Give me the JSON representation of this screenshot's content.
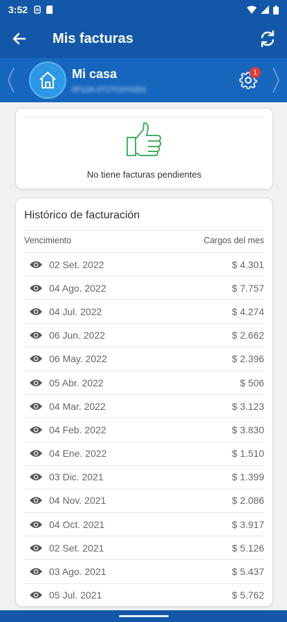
{
  "status": {
    "time": "3:52"
  },
  "appbar": {
    "title": "Mis facturas"
  },
  "account": {
    "name": "Mi casa",
    "subtitle": "0F1ZA-071TC0Y0201",
    "settings_badge": "1"
  },
  "pending": {
    "message": "No tiene facturas pendientes"
  },
  "history": {
    "title": "Histórico de facturación",
    "columns": {
      "due": "Vencimiento",
      "charges": "Cargos del mes"
    },
    "rows": [
      {
        "date": "02 Set. 2022",
        "amount": "$ 4.301"
      },
      {
        "date": "04 Ago. 2022",
        "amount": "$ 7.757"
      },
      {
        "date": "04 Jul. 2022",
        "amount": "$ 4.274"
      },
      {
        "date": "06 Jun. 2022",
        "amount": "$ 2.662"
      },
      {
        "date": "06 May. 2022",
        "amount": "$ 2.396"
      },
      {
        "date": "05 Abr. 2022",
        "amount": "$ 506"
      },
      {
        "date": "04 Mar. 2022",
        "amount": "$ 3.123"
      },
      {
        "date": "04 Feb. 2022",
        "amount": "$ 3.830"
      },
      {
        "date": "04 Ene. 2022",
        "amount": "$ 1.510"
      },
      {
        "date": "03 Dic. 2021",
        "amount": "$ 1.399"
      },
      {
        "date": "04 Nov. 2021",
        "amount": "$ 2.086"
      },
      {
        "date": "04 Oct. 2021",
        "amount": "$ 3.917"
      },
      {
        "date": "02 Set. 2021",
        "amount": "$ 5.126"
      },
      {
        "date": "03 Ago. 2021",
        "amount": "$ 5.437"
      },
      {
        "date": "05 Jul. 2021",
        "amount": "$ 5.762"
      }
    ]
  },
  "colors": {
    "primary": "#1358a8",
    "account_bar": "#1766be",
    "avatar": "#2d98e6",
    "thumb_icon": "#43b060",
    "badge": "#e53935"
  },
  "icons": {
    "back": "arrow-left-icon",
    "refresh": "refresh-icon",
    "home": "home-icon",
    "settings": "gear-icon",
    "thumb": "thumbs-up-icon",
    "view": "eye-icon"
  }
}
